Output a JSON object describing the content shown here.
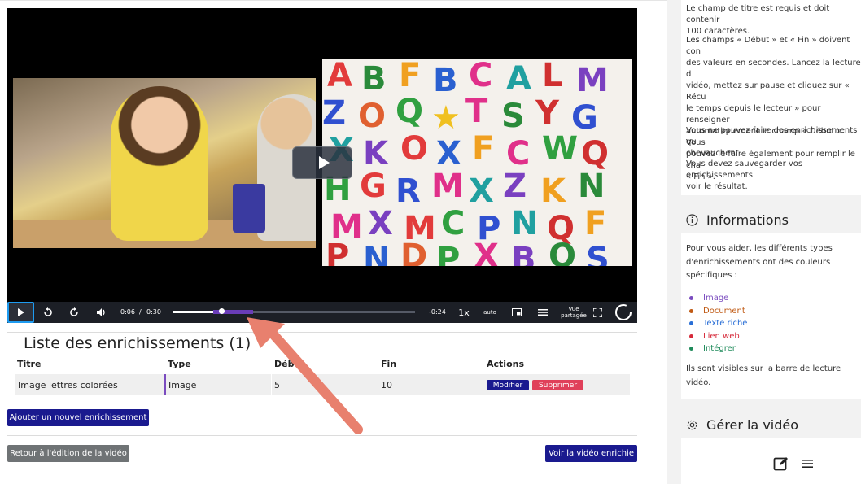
{
  "player": {
    "time_current": "0:06",
    "time_separator": "/",
    "time_total": "0:30",
    "time_remaining": "-0:24",
    "speed": "1x",
    "quality": "auto",
    "shared_view_line1": "Vue",
    "shared_view_line2": "partagée",
    "progress_fraction": 0.2,
    "enrichment_marker": {
      "start_fraction": 0.167,
      "end_fraction": 0.333,
      "color": "#6a3db8"
    },
    "icons": [
      "play-icon",
      "rewind-icon",
      "forward-icon",
      "volume-icon",
      "pip-icon",
      "chapters-icon",
      "fullscreen-icon",
      "spinner-icon"
    ]
  },
  "enrichments": {
    "title": "Liste des enrichissements (1)",
    "columns": [
      "Titre",
      "Type",
      "Début",
      "Fin",
      "Actions"
    ],
    "rows": [
      {
        "title": "Image lettres colorées",
        "type": "Image",
        "start": "5",
        "end": "10",
        "edit_label": "Modifier",
        "delete_label": "Supprimer"
      }
    ],
    "add_label": "Ajouter un nouvel enrichissement",
    "back_label": "Retour à l'édition de la vidéo",
    "view_label": "Voir la vidéo enrichie"
  },
  "sidebar": {
    "help_paragraph_1": "Le champ de titre est requis et doit contenir\n100 caractères.",
    "help_paragraph_2": "Les champs « Début » et « Fin » doivent con\ndes valeurs en secondes. Lancez la lecture d\nvidéo, mettez sur pause et cliquez sur « Récu\nle temps depuis le lecteur » pour renseigner\nautomatiquement le champ « Début ». Vous\npouvez le faire également pour remplir le cha\n« Fin ».",
    "help_paragraph_3": "Vous ne pouvez faire des enrichissements qu\nchevauchent.",
    "help_paragraph_4": "Vous devez sauvegarder vos enrichissements\nvoir le résultat.",
    "info_title": "Informations",
    "info_text": "Pour vous aider, les différents types\nd'enrichissements ont des couleurs\nspécifiques :",
    "legend": [
      {
        "label": "Image",
        "color": "#7a4bbf"
      },
      {
        "label": "Document",
        "color": "#c05a14"
      },
      {
        "label": "Texte riche",
        "color": "#2a6fd6"
      },
      {
        "label": "Lien web",
        "color": "#d62a3a"
      },
      {
        "label": "Intégrer",
        "color": "#1e8a5a"
      }
    ],
    "info_footer": "Ils sont visibles sur la barre de lecture\nvidéo.",
    "manage_title": "Gérer la vidéo"
  },
  "colors": {
    "primary": "#1a1a8f",
    "danger": "#e0405a",
    "secondary": "#6f7375",
    "annotation_arrow": "#e8806e"
  }
}
